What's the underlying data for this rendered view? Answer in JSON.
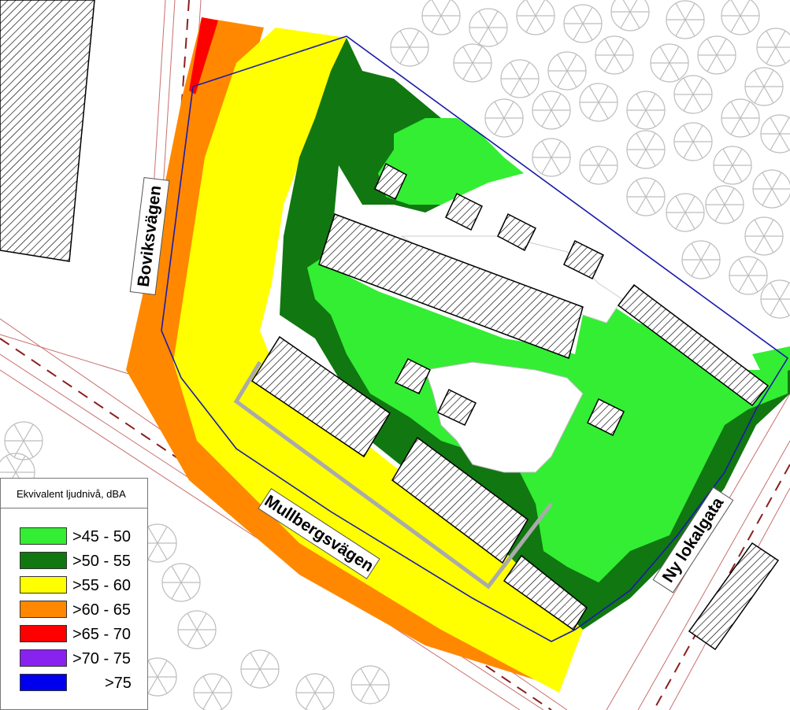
{
  "streets": {
    "boviksvagen": "Boviksvägen",
    "mullbergsvagen": "Mullbergsvägen",
    "ny_lokalgata": "Ny lokalgata"
  },
  "legend": {
    "title": "Ekvivalent ljudnivå, dBA",
    "items": [
      {
        "label": ">45 - 50",
        "color": "#33ee33"
      },
      {
        "label": ">50 - 55",
        "color": "#117711"
      },
      {
        "label": ">55 - 60",
        "color": "#ffff00"
      },
      {
        "label": ">60 - 65",
        "color": "#ff8800"
      },
      {
        "label": ">65 - 70",
        "color": "#ff0000"
      },
      {
        "label": ">70 - 75",
        "color": "#8822ee"
      },
      {
        "label": ">75",
        "color": "#0000ee"
      }
    ]
  },
  "colors": {
    "boundary": "#1a1aaa",
    "hatch": "#000000",
    "tree": "#bbbbbb",
    "road_line": "#cc6666"
  }
}
